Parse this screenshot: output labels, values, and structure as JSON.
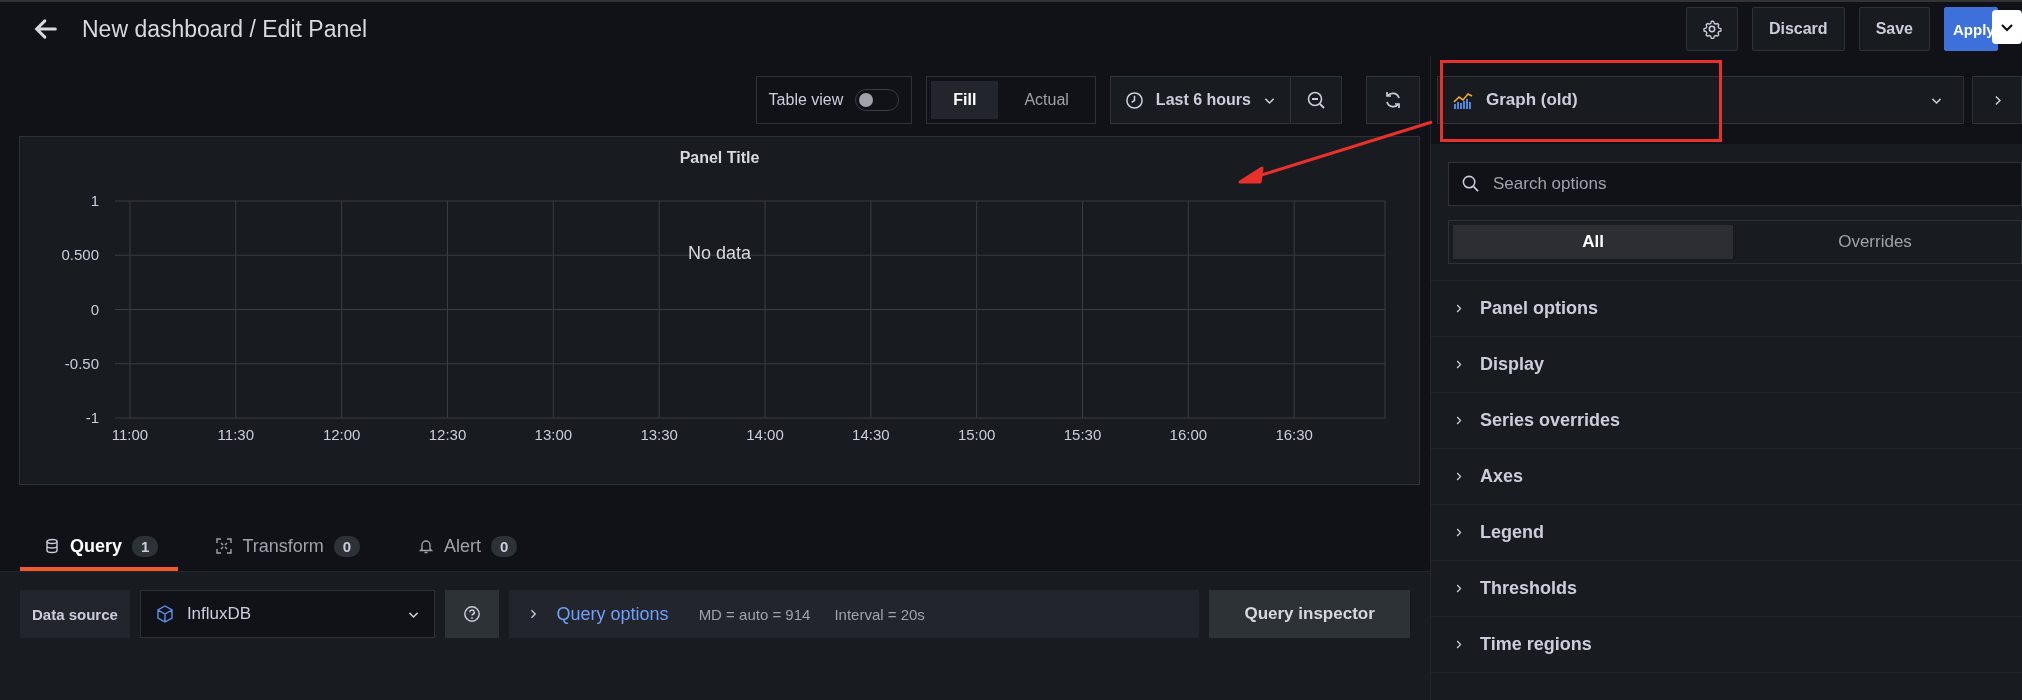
{
  "header": {
    "title": "New dashboard / Edit Panel",
    "buttons": [
      {
        "label": "Discard",
        "kind": "secondary"
      },
      {
        "label": "Save",
        "kind": "secondary"
      },
      {
        "label": "Apply",
        "kind": "primary"
      }
    ]
  },
  "toolbar": {
    "table_view": {
      "label": "Table view",
      "on": false
    },
    "size_modes": [
      {
        "label": "Fill",
        "selected": true
      },
      {
        "label": "Actual",
        "selected": false
      }
    ],
    "time_range": "Last 6 hours"
  },
  "visualization": {
    "label": "Graph (old)"
  },
  "panel": {
    "message": "No data",
    "chart_data": {
      "type": "line",
      "title": "Panel Title",
      "grid": true,
      "categories": [
        "11:00",
        "11:30",
        "12:00",
        "12:30",
        "13:00",
        "13:30",
        "14:00",
        "14:30",
        "15:00",
        "15:30",
        "16:00",
        "16:30"
      ],
      "ylim": [
        -1,
        1
      ],
      "yticks": [
        {
          "value": 1,
          "label": "1"
        },
        {
          "value": 0.5,
          "label": "0.500"
        },
        {
          "value": 0,
          "label": "0"
        },
        {
          "value": -0.5,
          "label": "-0.50"
        },
        {
          "value": -1,
          "label": "-1"
        }
      ]
    }
  },
  "editor_tabs": [
    {
      "label": "Query",
      "count": "1",
      "kind": "query",
      "selected": true
    },
    {
      "label": "Transform",
      "count": "0",
      "kind": "transform",
      "selected": false
    },
    {
      "label": "Alert",
      "count": "0",
      "kind": "alert",
      "selected": false
    }
  ],
  "query": {
    "data_source_label": "Data source",
    "data_source": "InfluxDB",
    "options_label": "Query options",
    "max_data_points": "MD = auto = 914",
    "interval": "Interval = 20s",
    "inspector": "Query inspector"
  },
  "options": {
    "search_placeholder": "Search options",
    "tabs": [
      {
        "label": "All",
        "selected": true
      },
      {
        "label": "Overrides",
        "selected": false
      }
    ],
    "sections": [
      {
        "label": "Panel options",
        "expanded": false
      },
      {
        "label": "Display",
        "expanded": false
      },
      {
        "label": "Series overrides",
        "expanded": false
      },
      {
        "label": "Axes",
        "expanded": false
      },
      {
        "label": "Legend",
        "expanded": false
      },
      {
        "label": "Thresholds",
        "expanded": false
      },
      {
        "label": "Time regions",
        "expanded": false
      }
    ]
  }
}
